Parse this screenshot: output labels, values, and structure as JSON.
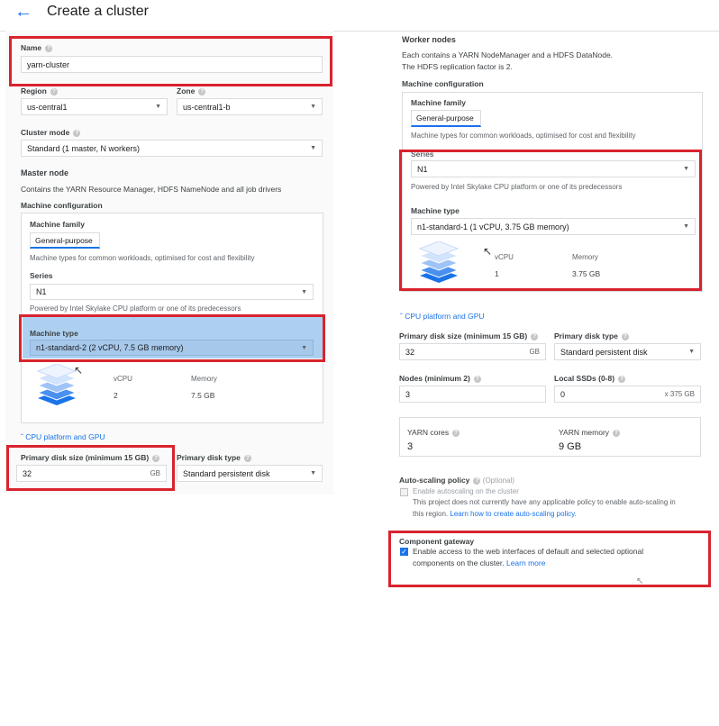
{
  "header": {
    "back_icon": "arrow-left-icon",
    "title": "Create a cluster"
  },
  "left": {
    "name_label": "Name",
    "name_value": "yarn-cluster",
    "region_label": "Region",
    "region_value": "us-central1",
    "zone_label": "Zone",
    "zone_value": "us-central1-b",
    "cluster_mode_label": "Cluster mode",
    "cluster_mode_value": "Standard (1 master, N workers)",
    "master_title": "Master node",
    "master_desc": "Contains the YARN Resource Manager, HDFS NameNode and all job drivers",
    "machine_config_label": "Machine configuration",
    "machine_family_label": "Machine family",
    "machine_family_chip": "General-purpose",
    "machine_family_desc": "Machine types for common workloads, optimised for cost and flexibility",
    "series_label": "Series",
    "series_value": "N1",
    "series_desc": "Powered by Intel Skylake CPU platform or one of its predecessors",
    "machine_type_label": "Machine type",
    "machine_type_value": "n1-standard-2 (2 vCPU, 7.5 GB memory)",
    "vcpu_label": "vCPU",
    "vcpu_value": "2",
    "memory_label": "Memory",
    "memory_value": "7.5 GB",
    "cpu_platform_link": "CPU platform and GPU",
    "disk_size_label": "Primary disk size (minimum 15 GB)",
    "disk_size_value": "32",
    "disk_size_unit": "GB",
    "disk_type_label": "Primary disk type",
    "disk_type_value": "Standard persistent disk"
  },
  "right": {
    "worker_title": "Worker nodes",
    "worker_desc_1": "Each contains a YARN NodeManager and a HDFS DataNode.",
    "worker_desc_2": "The HDFS replication factor is 2.",
    "machine_config_label": "Machine configuration",
    "machine_family_label": "Machine family",
    "machine_family_chip": "General-purpose",
    "machine_family_desc": "Machine types for common workloads, optimised for cost and flexibility",
    "series_label": "Series",
    "series_value": "N1",
    "series_desc": "Powered by Intel Skylake CPU platform or one of its predecessors",
    "machine_type_label": "Machine type",
    "machine_type_value": "n1-standard-1 (1 vCPU, 3.75 GB memory)",
    "vcpu_label": "vCPU",
    "vcpu_value": "1",
    "memory_label": "Memory",
    "memory_value": "3.75 GB",
    "cpu_platform_link": "CPU platform and GPU",
    "disk_size_label": "Primary disk size (minimum 15 GB)",
    "disk_size_value": "32",
    "disk_size_unit": "GB",
    "disk_type_label": "Primary disk type",
    "disk_type_value": "Standard persistent disk",
    "nodes_label": "Nodes (minimum 2)",
    "nodes_value": "3",
    "ssd_label": "Local SSDs (0-8)",
    "ssd_value": "0",
    "ssd_unit": "x 375 GB",
    "yarn_cores_label": "YARN cores",
    "yarn_cores_value": "3",
    "yarn_memory_label": "YARN memory",
    "yarn_memory_value": "9 GB",
    "autoscaling_label": "Auto-scaling policy",
    "autoscaling_optional": "(Optional)",
    "autoscaling_checkbox": "Enable autoscaling on the cluster",
    "autoscaling_note_1": "This project does not currently have any applicable policy to enable auto-scaling in",
    "autoscaling_note_2": "this region.",
    "autoscaling_link": "Learn how to create auto-scaling policy.",
    "gateway_label": "Component gateway",
    "gateway_text_1": "Enable access to the web interfaces of default and selected optional",
    "gateway_text_2": "components on the cluster.",
    "gateway_link": "Learn more"
  },
  "colors": {
    "accent": "#1a73e8",
    "highlight_box": "#d9232e",
    "selected_row": "#aed0f0"
  }
}
